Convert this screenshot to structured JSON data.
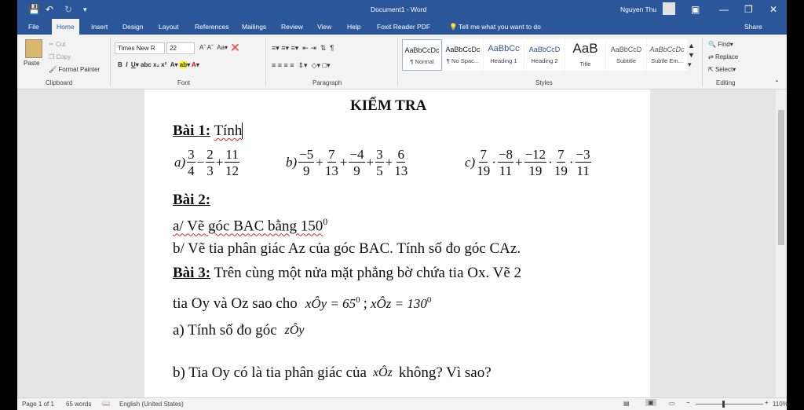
{
  "window": {
    "doc_title": "Document1 - Word",
    "user": "Nguyen Thu",
    "tell_me": "Tell me what you want to do",
    "share": "Share"
  },
  "menu": [
    "File",
    "Home",
    "Insert",
    "Design",
    "Layout",
    "References",
    "Mailings",
    "Review",
    "View",
    "Help",
    "Foxit Reader PDF"
  ],
  "clipboard": {
    "paste": "Paste",
    "cut": "Cut",
    "copy": "Copy",
    "format_painter": "Format Painter",
    "label": "Clipboard"
  },
  "font": {
    "name": "Times New R",
    "size": "22",
    "label": "Font"
  },
  "paragraph": {
    "label": "Paragraph"
  },
  "styles": {
    "label": "Styles",
    "items": [
      {
        "preview": "AaBbCcDc",
        "name": "¶ Normal"
      },
      {
        "preview": "AaBbCcDc",
        "name": "¶ No Spac..."
      },
      {
        "preview": "AaBbCc",
        "name": "Heading 1"
      },
      {
        "preview": "AaBbCcD",
        "name": "Heading 2"
      },
      {
        "preview": "AaB",
        "name": "Title"
      },
      {
        "preview": "AaBbCcD",
        "name": "Subtitle"
      },
      {
        "preview": "AaBbCcDc",
        "name": "Subtle Em..."
      }
    ]
  },
  "editing": {
    "find": "Find",
    "replace": "Replace",
    "select": "Select",
    "label": "Editing"
  },
  "document": {
    "title": "KIỂM TRA",
    "bai1_label": "Bài 1:",
    "bai1_text": "Tính",
    "a_label": "a)",
    "b_label": "b)",
    "c_label": "c)",
    "a_fracs": [
      [
        "3",
        "4"
      ],
      [
        "2",
        "3"
      ],
      [
        "11",
        "12"
      ]
    ],
    "a_ops": [
      "−",
      "+"
    ],
    "b_fracs": [
      [
        "−5",
        "9"
      ],
      [
        "7",
        "13"
      ],
      [
        "−4",
        "9"
      ],
      [
        "3",
        "5"
      ],
      [
        "6",
        "13"
      ]
    ],
    "b_ops": [
      "+",
      "+",
      "+",
      "+"
    ],
    "c_fracs": [
      [
        "7",
        "19"
      ],
      [
        "−8",
        "11"
      ],
      [
        "−12",
        "19"
      ],
      [
        "7",
        "19"
      ],
      [
        "−3",
        "11"
      ]
    ],
    "c_ops": [
      "·",
      "+",
      "·",
      "·"
    ],
    "bai2_label": "Bài 2:",
    "bai2_a": "a/ Vẽ góc BAC bằng 150",
    "bai2_a_sup": "0",
    "bai2_b": "b/ Vẽ tia phân giác Az của góc BAC. Tính số đo góc CAz.",
    "bai3_label": "Bài 3:",
    "bai3_text": "Trên cùng một nửa mặt phẳng bờ chứa tia Ox. Vẽ 2",
    "bai3_line2": "tia Oy và Oz sao cho",
    "xoy": "xÔy = 65",
    "xoz": "xÔz = 130",
    "bai3_a": "a) Tính số đo góc",
    "zoy": "zÔy",
    "bai3_b1": "b) Tia Oy có là tia phân giác của",
    "xoz2": "xÔz",
    "bai3_b2": "không? Vì sao?"
  },
  "status": {
    "page": "Page 1 of 1",
    "words": "65 words",
    "language": "English (United States)",
    "zoom": "110%"
  }
}
